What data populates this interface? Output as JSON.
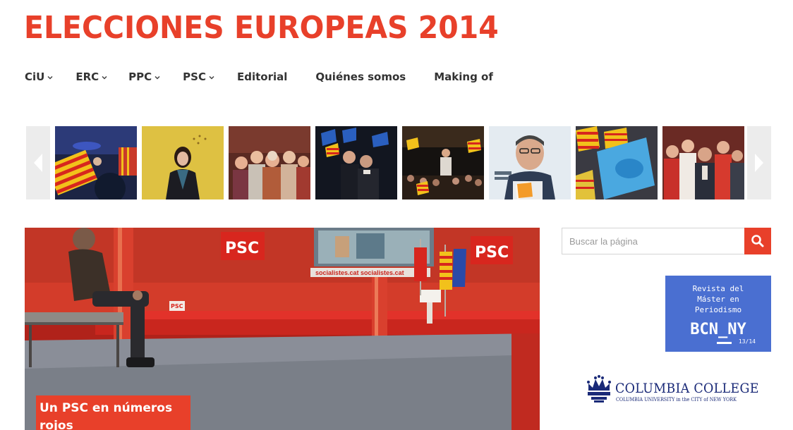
{
  "site": {
    "title": "ELECCIONES EUROPEAS 2014"
  },
  "nav": {
    "items": [
      {
        "label": "CiU",
        "has_dropdown": true
      },
      {
        "label": "ERC",
        "has_dropdown": true
      },
      {
        "label": "PPC",
        "has_dropdown": true
      },
      {
        "label": "PSC",
        "has_dropdown": true
      },
      {
        "label": "Editorial",
        "has_dropdown": false
      },
      {
        "label": "Quiénes somos",
        "has_dropdown": false
      },
      {
        "label": "Making of",
        "has_dropdown": false
      }
    ]
  },
  "carousel": {
    "prev_icon": "arrow-left-icon",
    "next_icon": "arrow-right-icon"
  },
  "hero": {
    "caption": "Un PSC en números rojos"
  },
  "search": {
    "placeholder": "Buscar la página",
    "icon": "search-icon"
  },
  "sidebar": {
    "revista": {
      "title": "Revista del Máster en Periodismo",
      "brand": "BCN_NY",
      "year": "13/14"
    },
    "columbia": {
      "name": "COLUMBIA COLLEGE",
      "subtitle": "COLUMBIA UNIVERSITY in the CITY of NEW YORK"
    }
  },
  "colors": {
    "accent": "#e8402a",
    "revista_blue": "#4a6fd1",
    "columbia_navy": "#1a2a78",
    "text_dark": "#333333"
  }
}
